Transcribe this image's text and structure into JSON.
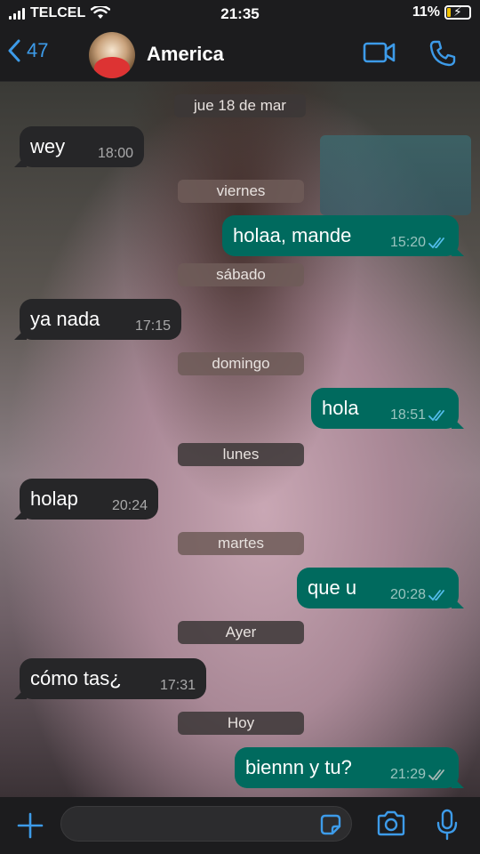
{
  "status_bar": {
    "carrier": "TELCEL",
    "time": "21:35",
    "battery": "11%"
  },
  "header": {
    "back_count": "47",
    "contact_name": "America"
  },
  "messages": [
    {
      "kind": "day",
      "label": "jue 18 de mar"
    },
    {
      "kind": "in",
      "text": "wey",
      "time": "18:00"
    },
    {
      "kind": "day",
      "label": "viernes"
    },
    {
      "kind": "out",
      "text": "holaa, mande",
      "time": "15:20"
    },
    {
      "kind": "day",
      "label": "sábado"
    },
    {
      "kind": "in",
      "text": "ya nada",
      "time": "17:15"
    },
    {
      "kind": "day",
      "label": "domingo"
    },
    {
      "kind": "out",
      "text": "hola",
      "time": "18:51"
    },
    {
      "kind": "day",
      "label": "lunes"
    },
    {
      "kind": "in",
      "text": "holap",
      "time": "20:24"
    },
    {
      "kind": "day",
      "label": "martes"
    },
    {
      "kind": "out",
      "text": "que u",
      "time": "20:28"
    },
    {
      "kind": "day",
      "label": "Ayer"
    },
    {
      "kind": "in",
      "text": "cómo tas¿",
      "time": "17:31"
    },
    {
      "kind": "day",
      "label": "Hoy"
    },
    {
      "kind": "out",
      "text": "biennn y tu?",
      "time": "21:29"
    }
  ],
  "input": {
    "placeholder": ""
  },
  "colors": {
    "accent": "#3d9be9",
    "outgoing_bubble": "#006a5e",
    "incoming_bubble": "#262628",
    "read_ticks": "#53bdeb",
    "delivered_ticks": "#a8b8b5"
  },
  "icons": [
    "wifi-icon",
    "battery-icon",
    "back-chevron-icon",
    "video-call-icon",
    "phone-call-icon",
    "plus-icon",
    "sticker-icon",
    "camera-icon",
    "microphone-icon",
    "double-check-icon"
  ]
}
